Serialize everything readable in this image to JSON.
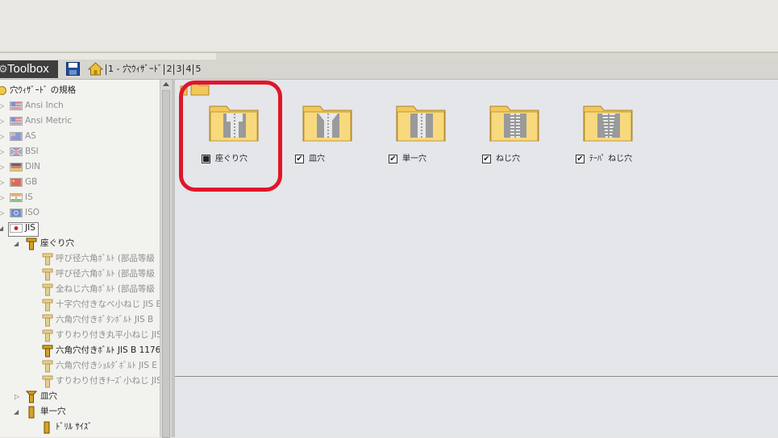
{
  "header": {
    "toolbox_title": "Toolbox",
    "tabs": [
      "1 - 穴ｳｨｻﾞｰﾄﾞ",
      "2",
      "3",
      "4",
      "5"
    ]
  },
  "tree": {
    "root_label": "穴ｳｨｻﾞｰﾄﾞ の規格",
    "standards": [
      {
        "label": "Ansi Inch",
        "flag": "us-flag-icon"
      },
      {
        "label": "Ansi Metric",
        "flag": "us-flag-icon"
      },
      {
        "label": "AS",
        "flag": "au-flag-icon"
      },
      {
        "label": "BSI",
        "flag": "uk-flag-icon"
      },
      {
        "label": "DIN",
        "flag": "de-flag-icon"
      },
      {
        "label": "GB",
        "flag": "cn-flag-icon"
      },
      {
        "label": "IS",
        "flag": "in-flag-icon"
      },
      {
        "label": "ISO",
        "flag": "iso-flag-icon"
      }
    ],
    "jis_label": "JIS",
    "counterbore_label": "座ぐり穴",
    "counterbore_children": [
      "呼び径六角ﾎﾞﾙﾄ (部品等級",
      "呼び径六角ﾎﾞﾙﾄ (部品等級",
      "全ねじ六角ﾎﾞﾙﾄ (部品等級",
      "十字穴付きなべ小ねじ JIS B",
      "六角穴付きﾎﾞﾀﾝﾎﾞﾙﾄ JIS B",
      "すりわり付き丸平小ねじ JIS",
      "六角穴付きﾎﾞﾙﾄ JIS B 1176",
      "六角穴付きｼｮﾙﾀﾞﾎﾞﾙﾄ JIS E",
      "すりわり付きﾁｰｽﾞ小ねじ JIS"
    ],
    "countersink_label": "皿穴",
    "simple_hole_label": "単一穴",
    "drill_size_label": "ﾄﾞﾘﾙ ｻｲｽﾞ"
  },
  "items": [
    {
      "label": "座ぐり穴",
      "check": "■"
    },
    {
      "label": "皿穴",
      "check": "✔"
    },
    {
      "label": "単一穴",
      "check": "✔"
    },
    {
      "label": "ねじ穴",
      "check": "✔"
    },
    {
      "label": "ﾃｰﾊﾟ ねじ穴",
      "check": "✔"
    }
  ],
  "colors": {
    "highlight": "#e0162a",
    "folder": "#f3c75a"
  }
}
